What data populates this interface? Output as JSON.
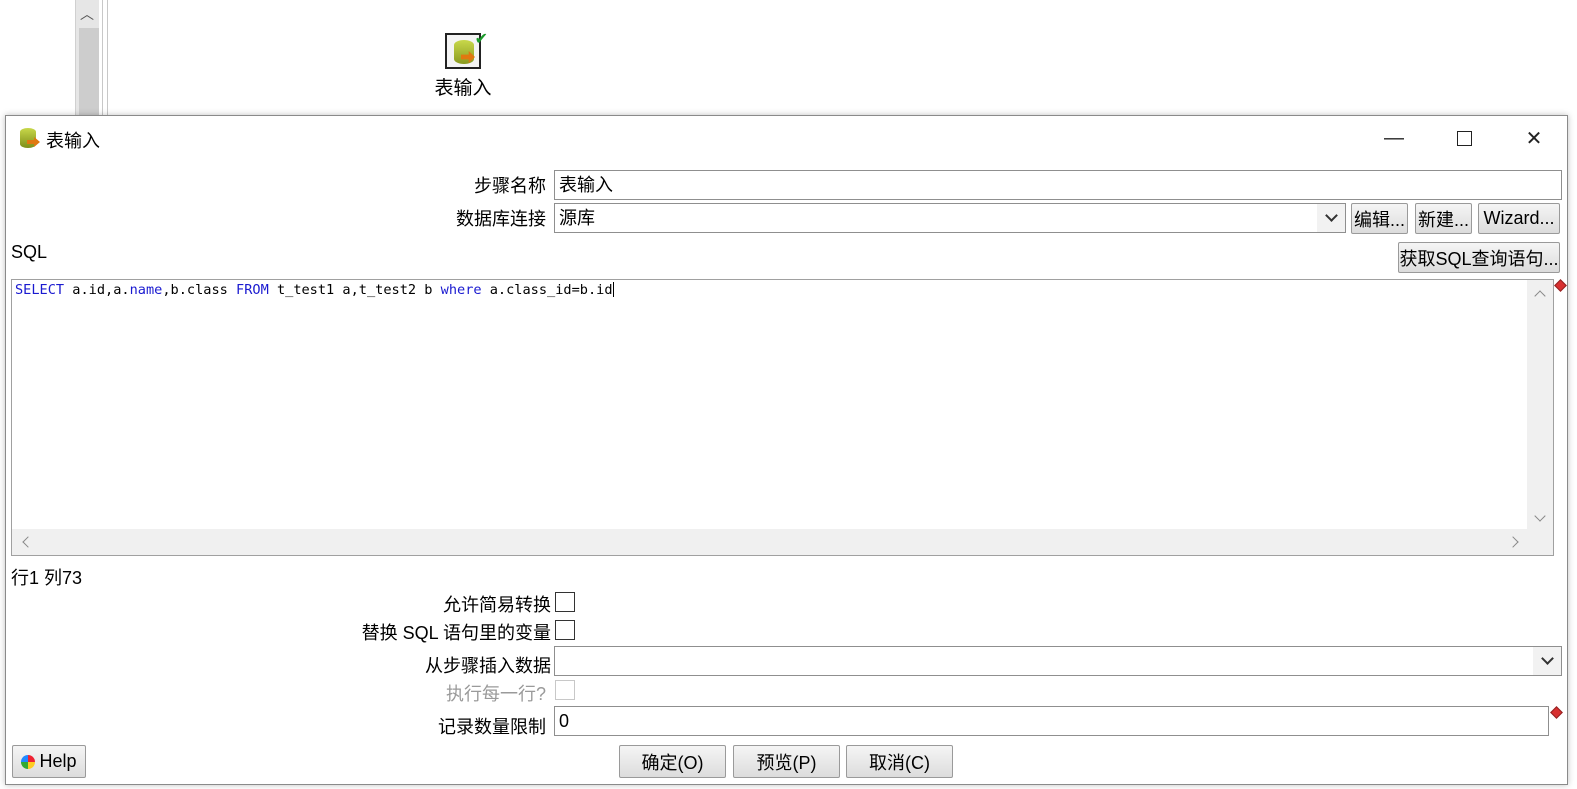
{
  "canvas": {
    "step_label": "表输入"
  },
  "window": {
    "title": "表输入",
    "minimize_icon": "minimize-icon",
    "maximize_icon": "maximize-icon",
    "close_icon": "close-icon"
  },
  "form": {
    "step_name_label": "步骤名称",
    "step_name_value": "表输入",
    "connection_label": "数据库连接",
    "connection_value": "源库",
    "edit_button": "编辑...",
    "new_button": "新建...",
    "wizard_button": "Wizard...",
    "sql_label": "SQL",
    "get_sql_button": "获取SQL查询语句...",
    "sql_tokens": [
      "SELECT",
      " a.id,a.",
      "name",
      ",b.class ",
      "FROM",
      " t_test1 a,t_test2 b ",
      "where",
      " a.class_id=b.id"
    ],
    "cursor_position": "行1 列73",
    "lazy_conversion_label": "允许简易转换",
    "lazy_conversion_checked": false,
    "replace_vars_label": "替换 SQL 语句里的变量",
    "replace_vars_checked": false,
    "insert_from_step_label": "从步骤插入数据",
    "insert_from_step_value": "",
    "execute_each_row_label": "执行每一行?",
    "execute_each_row_checked": false,
    "limit_label": "记录数量限制",
    "limit_value": "0"
  },
  "footer": {
    "help_button": "Help",
    "ok_button": "确定(O)",
    "preview_button": "预览(P)",
    "cancel_button": "取消(C)"
  },
  "colors": {
    "sql_keyword": "#1a1ad0",
    "required_marker": "#d83030"
  }
}
